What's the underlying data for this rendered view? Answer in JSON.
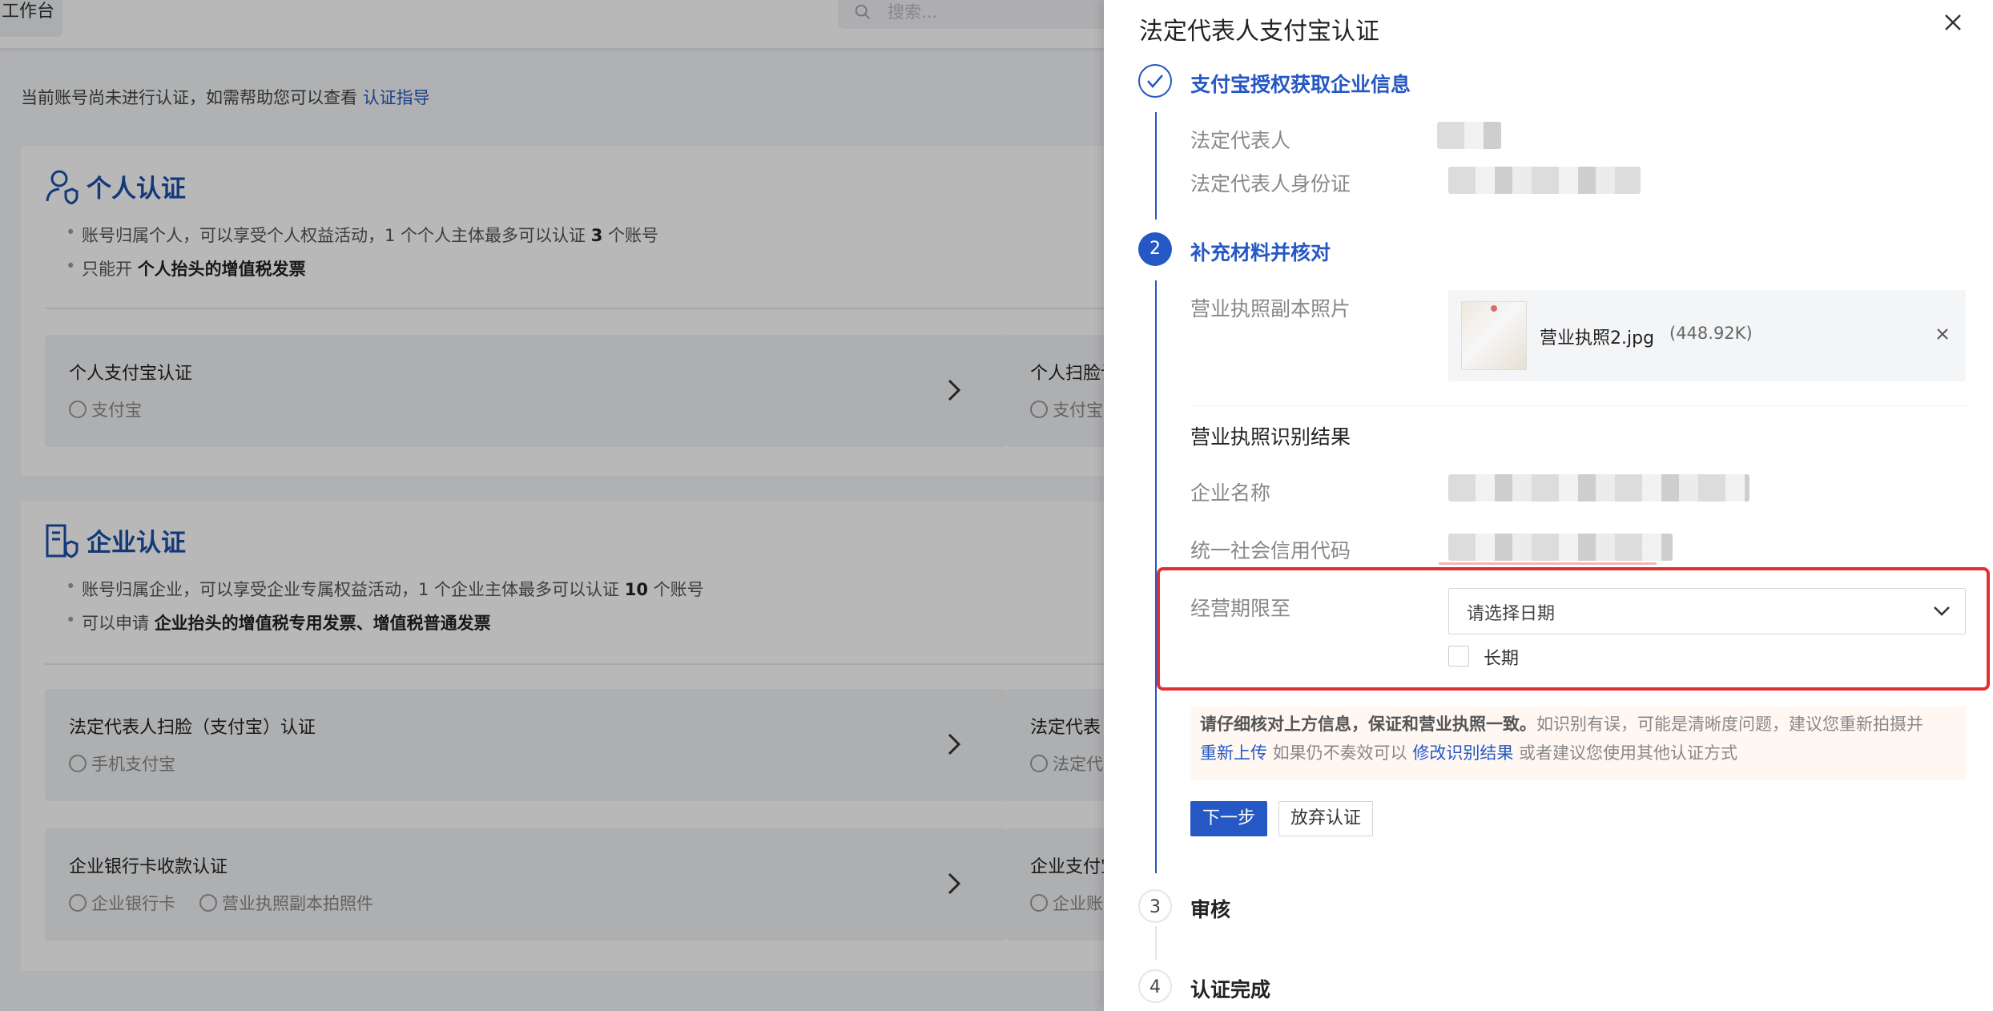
{
  "background": {
    "workspace_tab": "工作台",
    "search_placeholder": "搜索...",
    "notice_text": "当前账号尚未进行认证，如需帮助您可以查看",
    "notice_link": "认证指导",
    "personal": {
      "title": "个人认证",
      "bullet1_pre": "账号归属个人，可以享受个人权益活动，1 个个人主体最多可以认证 ",
      "bullet1_num": "3",
      "bullet1_post": " 个账号",
      "bullet2_pre": "只能开 ",
      "bullet2_bold": "个人抬头的增值税发票",
      "options": [
        {
          "title": "个人支付宝认证",
          "sub1": "支付宝"
        },
        {
          "title": "个人扫脸认",
          "sub1": "支付宝"
        }
      ]
    },
    "enterprise": {
      "title": "企业认证",
      "bullet1_pre": "账号归属企业，可以享受企业专属权益活动，1 个企业主体最多可以认证 ",
      "bullet1_num": "10",
      "bullet1_post": " 个账号",
      "bullet2_pre": "可以申请 ",
      "bullet2_bold": "企业抬头的增值税专用发票、增值税普通发票",
      "options": [
        {
          "title": "法定代表人扫脸（支付宝）认证",
          "sub1": "手机支付宝"
        },
        {
          "title": "法定代表",
          "sub1": "法定代"
        },
        {
          "title": "企业银行卡收款认证",
          "sub1": "企业银行卡",
          "sub2": "营业执照副本拍照件"
        },
        {
          "title": "企业支付宝",
          "sub1": "企业账"
        }
      ]
    }
  },
  "drawer": {
    "title": "法定代表人支付宝认证",
    "steps": [
      {
        "num": "",
        "title": "支付宝授权获取企业信息",
        "status": "done"
      },
      {
        "num": "2",
        "title": "补充材料并核对",
        "status": "active"
      },
      {
        "num": "3",
        "title": "审核",
        "status": "todo"
      },
      {
        "num": "4",
        "title": "认证完成",
        "status": "todo"
      }
    ],
    "step1": {
      "legal_rep_label": "法定代表人",
      "legal_rep_id_label": "法定代表人身份证"
    },
    "step2": {
      "license_photo_label": "营业执照副本照片",
      "file_name": "营业执照2.jpg",
      "file_size": "(448.92K)",
      "recognition_title": "营业执照识别结果",
      "company_name_label": "企业名称",
      "credit_code_label": "统一社会信用代码",
      "business_term_label": "经营期限至",
      "date_placeholder": "请选择日期",
      "long_term_label": "长期",
      "tip_bold": "请仔细核对上方信息，保证和营业执照一致。",
      "tip_rest": "如识别有误，可能是清晰度问题，建议您重新拍摄并",
      "tip_link1": "重新上传",
      "tip_mid": " 如果仍不奏效可以 ",
      "tip_link2": "修改识别结果",
      "tip_end": " 或者建议您使用其他认证方式",
      "next_button": "下一步",
      "abandon_button": "放弃认证"
    }
  },
  "colors": {
    "primary": "#2558c5",
    "highlight": "#e03030",
    "overlay": "rgba(0,0,0,0.28)"
  }
}
